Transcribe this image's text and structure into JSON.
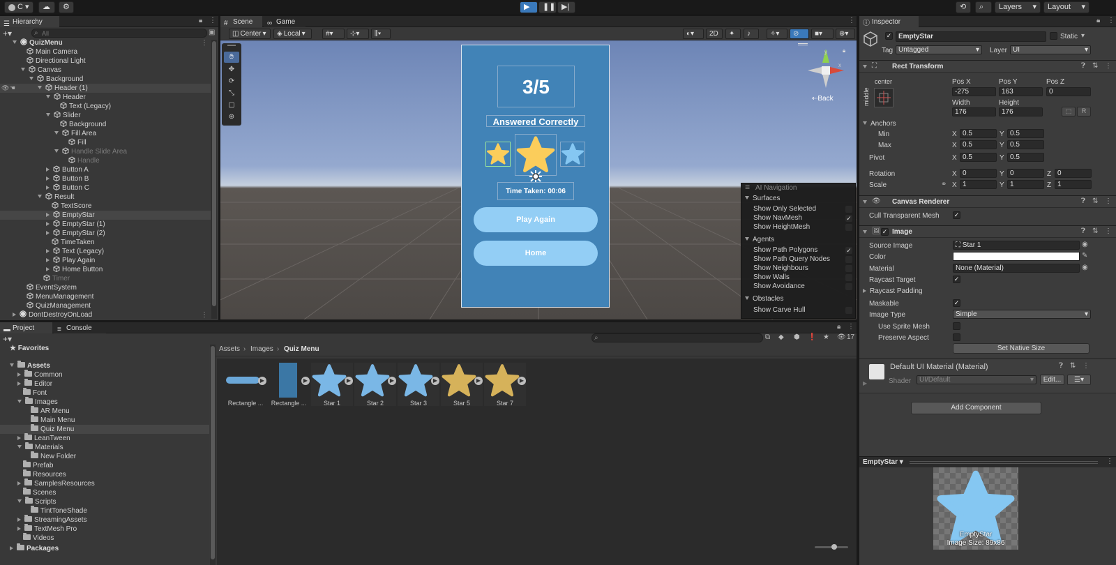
{
  "toolbar": {
    "account": "C",
    "layers": "Layers",
    "layout": "Layout"
  },
  "hierarchy": {
    "tab": "Hierarchy",
    "search_placeholder": "All",
    "items": [
      {
        "label": "QuizMenu",
        "indent": 0,
        "exp": "open",
        "bold": true,
        "icon": "unity"
      },
      {
        "label": "Main Camera",
        "indent": 1,
        "exp": "",
        "icon": "cube"
      },
      {
        "label": "Directional Light",
        "indent": 1,
        "exp": "",
        "icon": "cube"
      },
      {
        "label": "Canvas",
        "indent": 1,
        "exp": "open",
        "icon": "cube"
      },
      {
        "label": "Background",
        "indent": 2,
        "exp": "open",
        "icon": "cube"
      },
      {
        "label": "Header (1)",
        "indent": 3,
        "exp": "open",
        "icon": "cube",
        "hover": true
      },
      {
        "label": "Header",
        "indent": 4,
        "exp": "open",
        "icon": "cube"
      },
      {
        "label": "Text (Legacy)",
        "indent": 5,
        "exp": "",
        "icon": "cube"
      },
      {
        "label": "Slider",
        "indent": 4,
        "exp": "open",
        "icon": "cube"
      },
      {
        "label": "Background",
        "indent": 5,
        "exp": "",
        "icon": "cube"
      },
      {
        "label": "Fill Area",
        "indent": 5,
        "exp": "open",
        "icon": "cube"
      },
      {
        "label": "Fill",
        "indent": 6,
        "exp": "",
        "icon": "cube"
      },
      {
        "label": "Handle Slide Area",
        "indent": 5,
        "exp": "open",
        "icon": "cube",
        "dim": true
      },
      {
        "label": "Handle",
        "indent": 6,
        "exp": "",
        "icon": "cube",
        "dim": true
      },
      {
        "label": "Button A",
        "indent": 4,
        "exp": "closed",
        "icon": "cube"
      },
      {
        "label": "Button B",
        "indent": 4,
        "exp": "closed",
        "icon": "cube"
      },
      {
        "label": "Button C",
        "indent": 4,
        "exp": "closed",
        "icon": "cube"
      },
      {
        "label": "Result",
        "indent": 3,
        "exp": "open",
        "icon": "cube"
      },
      {
        "label": "TextScore",
        "indent": 4,
        "exp": "",
        "icon": "cube"
      },
      {
        "label": "EmptyStar",
        "indent": 4,
        "exp": "closed",
        "icon": "cube",
        "selected": true
      },
      {
        "label": "EmptyStar (1)",
        "indent": 4,
        "exp": "closed",
        "icon": "cube"
      },
      {
        "label": "EmptyStar (2)",
        "indent": 4,
        "exp": "closed",
        "icon": "cube"
      },
      {
        "label": "TimeTaken",
        "indent": 4,
        "exp": "",
        "icon": "cube"
      },
      {
        "label": "Text (Legacy)",
        "indent": 4,
        "exp": "closed",
        "icon": "cube"
      },
      {
        "label": "Play Again",
        "indent": 4,
        "exp": "closed",
        "icon": "cube"
      },
      {
        "label": "Home Button",
        "indent": 4,
        "exp": "closed",
        "icon": "cube"
      },
      {
        "label": "Timer",
        "indent": 3,
        "exp": "",
        "icon": "cube",
        "dim": true
      },
      {
        "label": "EventSystem",
        "indent": 1,
        "exp": "",
        "icon": "cube"
      },
      {
        "label": "MenuManagement",
        "indent": 1,
        "exp": "",
        "icon": "cube"
      },
      {
        "label": "QuizManagement",
        "indent": 1,
        "exp": "",
        "icon": "cube"
      },
      {
        "label": "DontDestroyOnLoad",
        "indent": 0,
        "exp": "closed",
        "icon": "unity"
      }
    ]
  },
  "scene": {
    "tab_scene": "Scene",
    "tab_game": "Game",
    "pivot": "Center",
    "space": "Local",
    "mode_2d": "2D",
    "back": "Back",
    "ui": {
      "score": "3/5",
      "answered": "Answered Correctly",
      "time": "Time Taken: 00:06",
      "play_again": "Play Again",
      "home": "Home"
    },
    "ai_nav": {
      "title": "AI Navigation",
      "surfaces": "Surfaces",
      "show_only_selected": "Show Only Selected",
      "show_navmesh": "Show NavMesh",
      "show_heightmesh": "Show HeightMesh",
      "agents": "Agents",
      "show_path_polygons": "Show Path Polygons",
      "show_path_query_nodes": "Show Path Query Nodes",
      "show_neighbours": "Show Neighbours",
      "show_walls": "Show Walls",
      "show_avoidance": "Show Avoidance",
      "obstacles": "Obstacles",
      "show_carve_hull": "Show Carve Hull"
    }
  },
  "inspector": {
    "tab": "Inspector",
    "name": "EmptyStar",
    "static": "Static",
    "tag_label": "Tag",
    "tag": "Untagged",
    "layer_label": "Layer",
    "layer": "UI",
    "rect_transform": "Rect Transform",
    "anchor_h": "center",
    "anchor_v": "middle",
    "pos_x_label": "Pos X",
    "pos_y_label": "Pos Y",
    "pos_z_label": "Pos Z",
    "pos_x": "-275",
    "pos_y": "163",
    "pos_z": "0",
    "width_label": "Width",
    "height_label": "Height",
    "width": "176",
    "height": "176",
    "r_btn": "R",
    "anchors": "Anchors",
    "min": "Min",
    "max": "Max",
    "pivot": "Pivot",
    "rotation": "Rotation",
    "scale": "Scale",
    "x": "X",
    "y": "Y",
    "z": "Z",
    "half": "0.5",
    "zero": "0",
    "one": "1",
    "canvas_renderer": "Canvas Renderer",
    "cull": "Cull Transparent Mesh",
    "image": "Image",
    "source_image_label": "Source Image",
    "source_image": "Star 1",
    "color_label": "Color",
    "material_label": "Material",
    "material": "None (Material)",
    "raycast_target": "Raycast Target",
    "raycast_padding": "Raycast Padding",
    "maskable": "Maskable",
    "image_type_label": "Image Type",
    "image_type": "Simple",
    "use_sprite_mesh": "Use Sprite Mesh",
    "preserve_aspect": "Preserve Aspect",
    "set_native_size": "Set Native Size",
    "default_material": "Default UI Material (Material)",
    "shader_label": "Shader",
    "shader": "UI/Default",
    "edit": "Edit...",
    "add_component": "Add Component",
    "preview_name": "EmptyStar",
    "preview_caption1": "EmptyStar",
    "preview_caption2": "Image Size: 89x86"
  },
  "project": {
    "tab_project": "Project",
    "tab_console": "Console",
    "breadcrumb": [
      "Assets",
      "Images",
      "Quiz Menu"
    ],
    "count": "17",
    "favorites": "Favorites",
    "tree": [
      {
        "label": "Assets",
        "indent": 0,
        "exp": "open",
        "bold": true
      },
      {
        "label": "Common",
        "indent": 1,
        "exp": "closed"
      },
      {
        "label": "Editor",
        "indent": 1,
        "exp": "closed"
      },
      {
        "label": "Font",
        "indent": 1,
        "exp": ""
      },
      {
        "label": "Images",
        "indent": 1,
        "exp": "open"
      },
      {
        "label": "AR Menu",
        "indent": 2,
        "exp": ""
      },
      {
        "label": "Main Menu",
        "indent": 2,
        "exp": ""
      },
      {
        "label": "Quiz Menu",
        "indent": 2,
        "exp": "",
        "selected": true
      },
      {
        "label": "LeanTween",
        "indent": 1,
        "exp": "closed"
      },
      {
        "label": "Materials",
        "indent": 1,
        "exp": "open"
      },
      {
        "label": "New Folder",
        "indent": 2,
        "exp": ""
      },
      {
        "label": "Prefab",
        "indent": 1,
        "exp": ""
      },
      {
        "label": "Resources",
        "indent": 1,
        "exp": ""
      },
      {
        "label": "SamplesResources",
        "indent": 1,
        "exp": "closed"
      },
      {
        "label": "Scenes",
        "indent": 1,
        "exp": ""
      },
      {
        "label": "Scripts",
        "indent": 1,
        "exp": "open"
      },
      {
        "label": "TintToneShade",
        "indent": 2,
        "exp": ""
      },
      {
        "label": "StreamingAssets",
        "indent": 1,
        "exp": "closed"
      },
      {
        "label": "TextMesh Pro",
        "indent": 1,
        "exp": "closed"
      },
      {
        "label": "Videos",
        "indent": 1,
        "exp": ""
      },
      {
        "label": "Packages",
        "indent": 0,
        "exp": "closed",
        "bold": true
      }
    ],
    "assets": [
      {
        "label": "Rectangle ...",
        "kind": "bar",
        "color": "#6ba7d8"
      },
      {
        "label": "Rectangle ...",
        "kind": "rect",
        "color": "#3b77a5"
      },
      {
        "label": "Star 1",
        "kind": "star",
        "color": "#7ab7e6"
      },
      {
        "label": "Star 2",
        "kind": "star",
        "color": "#7ab7e6"
      },
      {
        "label": "Star 3",
        "kind": "star",
        "color": "#7ab7e6"
      },
      {
        "label": "Star 5",
        "kind": "star",
        "color": "#d6b25a"
      },
      {
        "label": "Star 7",
        "kind": "star",
        "color": "#d6b25a"
      }
    ]
  },
  "colors": {
    "accent": "#3a79bb",
    "star_yellow": "#fbcd5b",
    "star_blue": "#85c7f2",
    "card_blue": "#4183b7"
  }
}
